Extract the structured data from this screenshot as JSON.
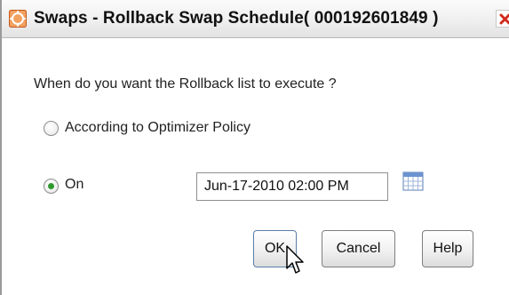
{
  "dialog": {
    "title": "Swaps - Rollback Swap Schedule( 000192601849 )",
    "app_icon": "app-logo-icon",
    "close_icon": "close-icon"
  },
  "prompt": "When do you want the Rollback list to execute ?",
  "options": [
    {
      "label": "According to Optimizer Policy",
      "selected": false
    },
    {
      "label": "On",
      "selected": true
    }
  ],
  "date_field": {
    "value": "Jun-17-2010 02:00 PM",
    "icon": "calendar-icon"
  },
  "buttons": {
    "ok": "OK",
    "cancel": "Cancel",
    "help": "Help"
  },
  "colors": {
    "radio_selected": "#2e9a2e",
    "close": "#d12a1c",
    "app_icon": "#e8742a"
  }
}
